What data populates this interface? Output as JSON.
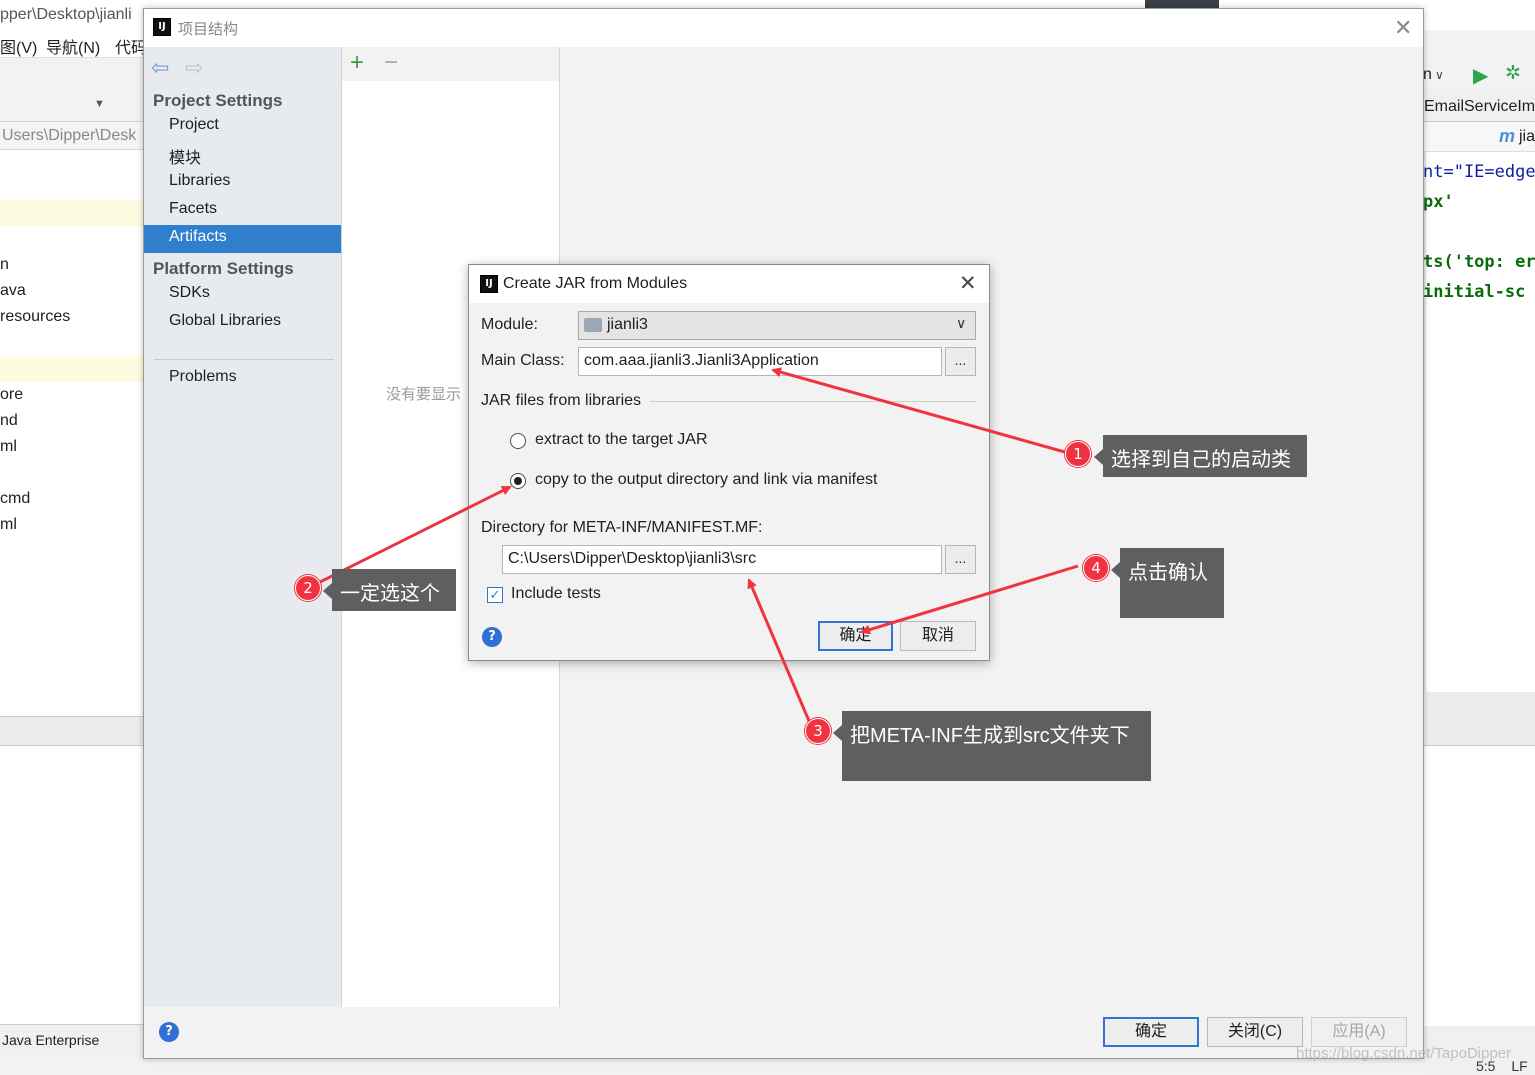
{
  "background_ide": {
    "title_fragment": "pper\\Desktop\\jianli",
    "menu": [
      "图(V)",
      "导航(N)",
      "代码"
    ],
    "path_fragment": "Users\\Dipper\\Desk",
    "tree_fragments": [
      "n",
      "ava",
      "resources",
      "ore",
      "nd",
      "ml",
      "cmd",
      "ml"
    ],
    "status_fragment": "Java Enterprise",
    "right_run_config": "n",
    "right_tab": "EmailServiceIm",
    "right_tab2": "jia",
    "code_lines": [
      "nt=\"IE=edge",
      "px'",
      "ts('top: er",
      "initial-sc"
    ],
    "status_position": "5:5",
    "status_lf": "LF"
  },
  "project_structure": {
    "title": "项目结构",
    "sidebar": {
      "group_project": "Project Settings",
      "project_items": [
        "Project",
        "模块",
        "Libraries",
        "Facets",
        "Artifacts"
      ],
      "selected": "Artifacts",
      "group_platform": "Platform Settings",
      "platform_items": [
        "SDKs",
        "Global Libraries"
      ],
      "problems": "Problems"
    },
    "middle_empty_text": "没有要显示",
    "buttons": {
      "ok": "确定",
      "close": "关闭(C)",
      "apply": "应用(A)"
    }
  },
  "jar_dialog": {
    "title": "Create JAR from Modules",
    "module_label": "Module:",
    "module_value": "jianli3",
    "main_class_label": "Main Class:",
    "main_class_value": "com.aaa.jianli3.Jianli3Application",
    "browse_label": "...",
    "jar_files_label": "JAR files from libraries",
    "option_extract": "extract to the target JAR",
    "option_copy": "copy to the output directory and link via manifest",
    "selected_option": "copy",
    "manifest_dir_label": "Directory for META-INF/MANIFEST.MF:",
    "manifest_dir_value": "C:\\Users\\Dipper\\Desktop\\jianli3\\src",
    "include_tests_label": "Include tests",
    "include_tests_checked": true,
    "ok_label": "确定",
    "cancel_label": "取消"
  },
  "annotations": [
    {
      "number": "1",
      "text": "选择到自己的启动类"
    },
    {
      "number": "2",
      "text": "一定选这个"
    },
    {
      "number": "3",
      "text": "把META-INF生成到src文件夹下"
    },
    {
      "number": "4",
      "text": "点击确认"
    }
  ],
  "watermark": "https://blog.csdn.net/TapoDipper",
  "colors": {
    "selection": "#2f7fcc",
    "annotation_red": "#ef3340",
    "callout_bg": "#5f5f5f",
    "primary_border": "#2f76d2"
  }
}
